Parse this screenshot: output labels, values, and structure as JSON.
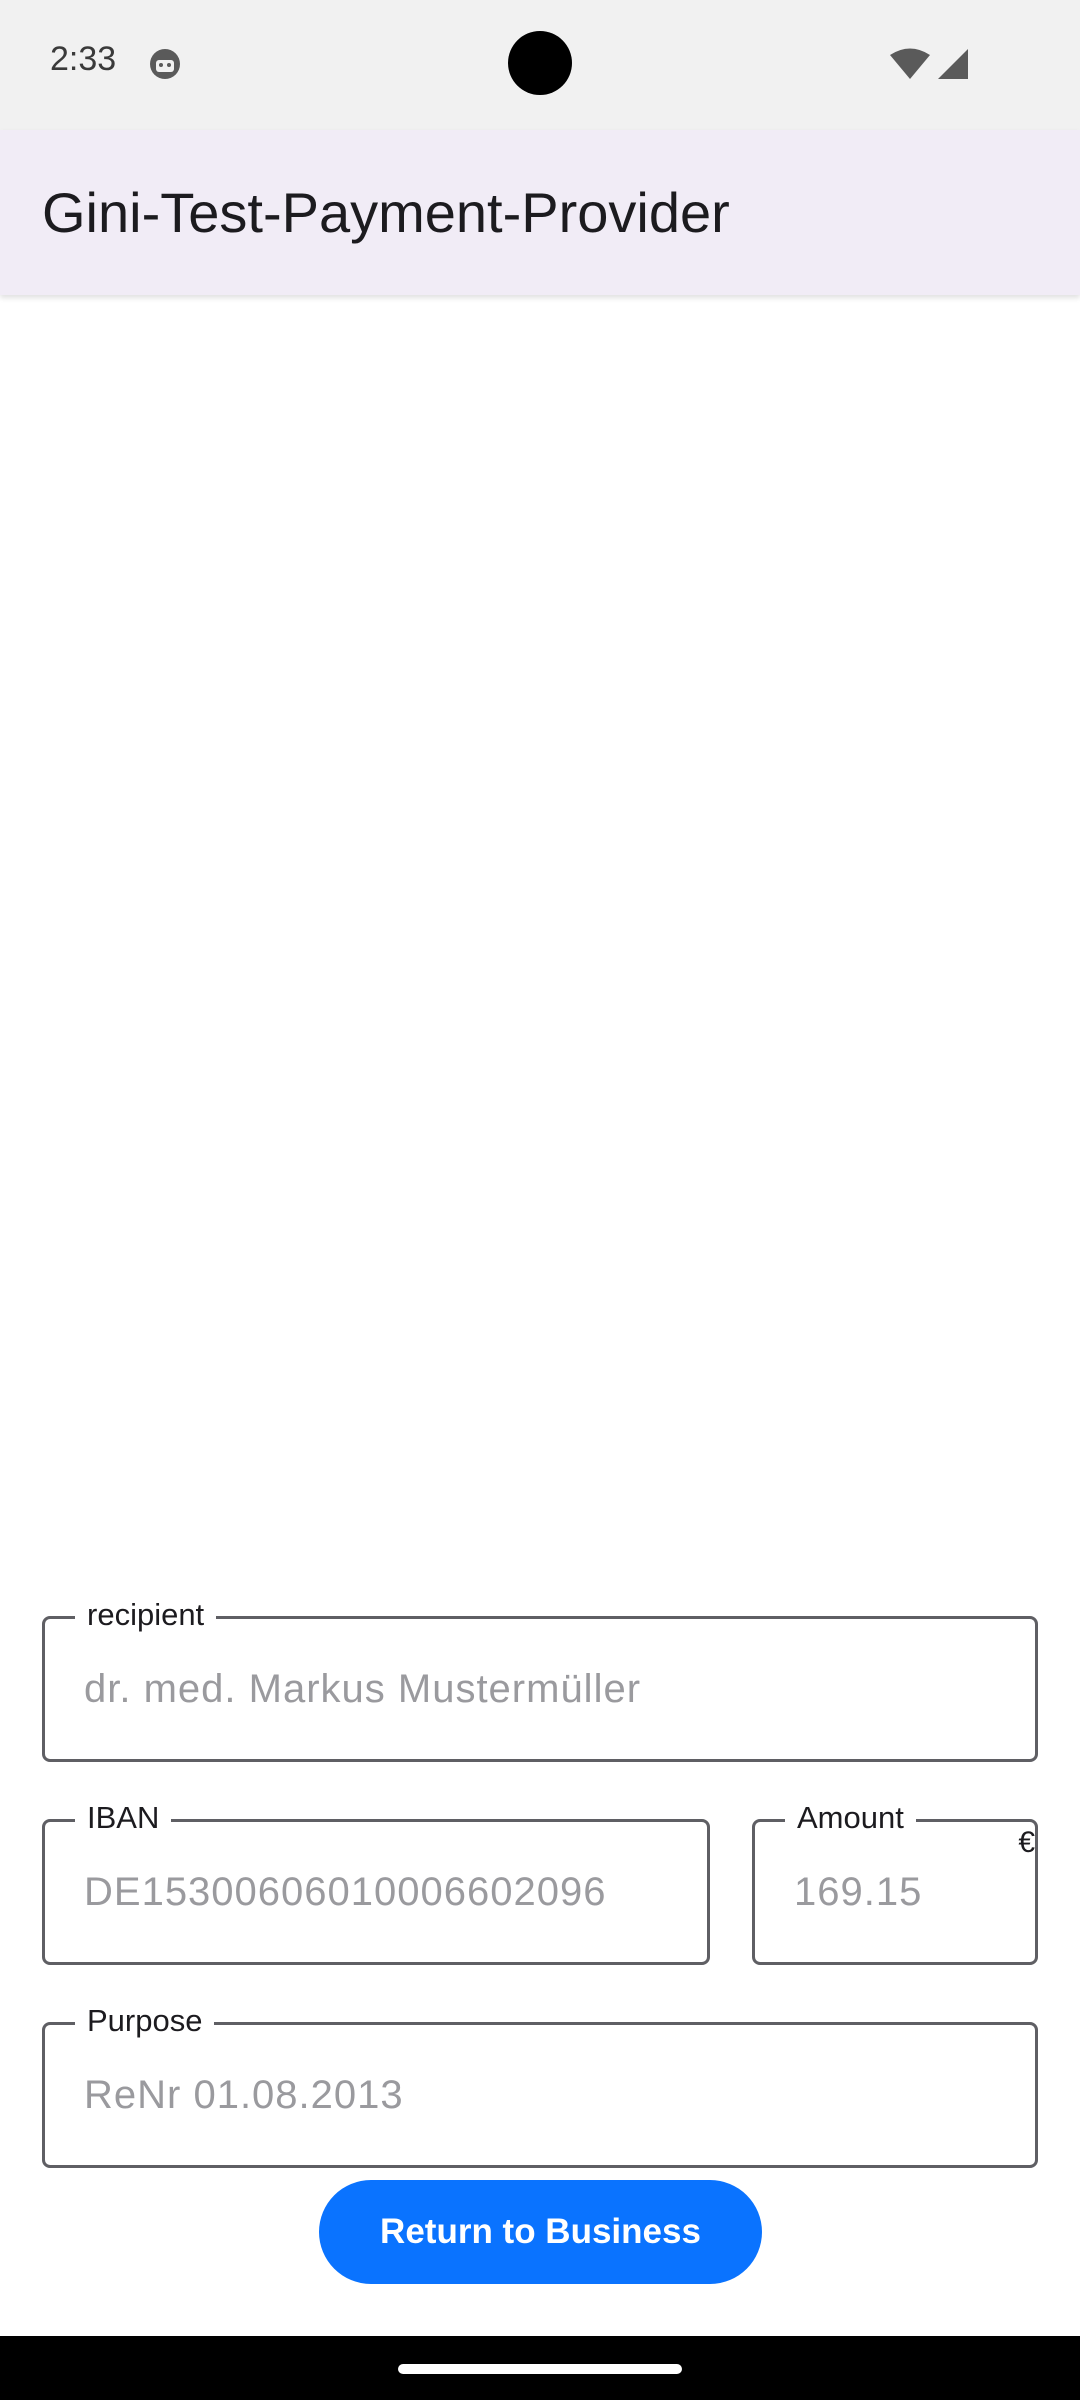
{
  "status_bar": {
    "time": "2:33",
    "icons": [
      "app-notification-icon",
      "wifi-icon",
      "cellular-signal-icon"
    ]
  },
  "app_bar": {
    "title": "Gini-Test-Payment-Provider",
    "background": "#f1ecf6"
  },
  "form": {
    "recipient": {
      "label": "recipient",
      "value": "dr. med. Markus Mustermüller"
    },
    "iban": {
      "label": "IBAN",
      "value": "DE15300606010006602096"
    },
    "amount": {
      "label": "Amount",
      "value": "169.15",
      "currency": "€"
    },
    "purpose": {
      "label": "Purpose",
      "value": "ReNr 01.08.2013"
    }
  },
  "actions": {
    "return_label": "Return to Business",
    "return_color": "#0a73ff"
  }
}
